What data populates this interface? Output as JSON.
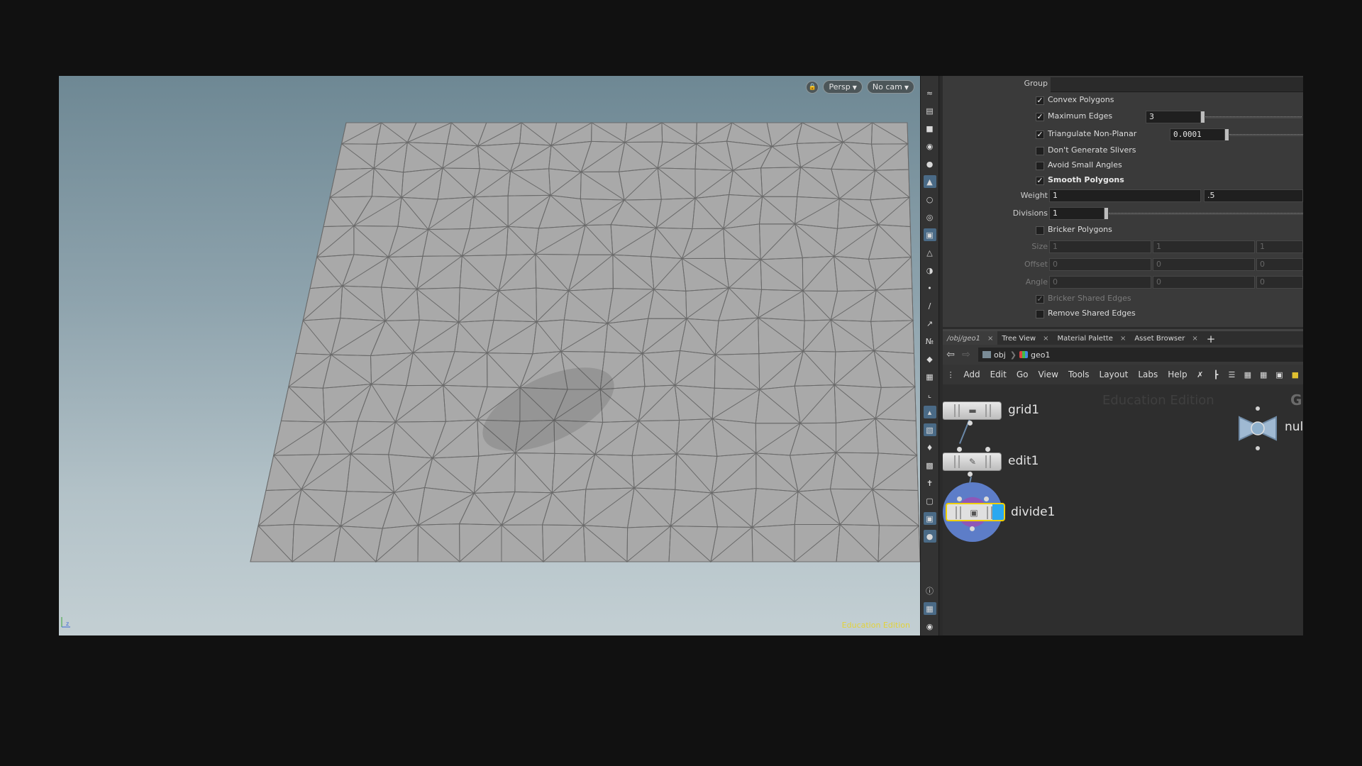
{
  "viewport": {
    "persp_label": "Persp",
    "cam_label": "No cam",
    "watermark": "Education Edition",
    "axis_label": "z"
  },
  "params": {
    "group_label": "Group",
    "convex_polygons": "Convex Polygons",
    "maximum_edges": "Maximum Edges",
    "maximum_edges_value": "3",
    "triangulate_non_planar": "Triangulate Non-Planar",
    "triangulate_value": "0.0001",
    "dont_generate_slivers": "Don't Generate Slivers",
    "avoid_small_angles": "Avoid Small Angles",
    "smooth_polygons": "Smooth Polygons",
    "weight_label": "Weight",
    "weight_value_1": "1",
    "weight_value_2": ".5",
    "divisions_label": "Divisions",
    "divisions_value": "1",
    "bricker_polygons": "Bricker Polygons",
    "size_label": "Size",
    "size_values": [
      "1",
      "1",
      "1"
    ],
    "offset_label": "Offset",
    "offset_values": [
      "0",
      "0",
      "0"
    ],
    "angle_label": "Angle",
    "angle_values": [
      "0",
      "0",
      "0"
    ],
    "bricker_shared_edges": "Bricker Shared Edges",
    "remove_shared_edges": "Remove Shared Edges"
  },
  "tabs": [
    {
      "label": "/obj/geo1"
    },
    {
      "label": "Tree View"
    },
    {
      "label": "Material Palette"
    },
    {
      "label": "Asset Browser"
    }
  ],
  "path": {
    "root": "obj",
    "current": "geo1"
  },
  "menu": [
    "Add",
    "Edit",
    "Go",
    "View",
    "Tools",
    "Layout",
    "Labs",
    "Help"
  ],
  "network": {
    "watermark": "Education Edition",
    "corner_glyph": "G",
    "nodes": [
      {
        "name": "grid1"
      },
      {
        "name": "edit1"
      },
      {
        "name": "divide1"
      }
    ],
    "null_partial": "nul"
  },
  "colors": {
    "selected_outline": "#f0d000",
    "display_flag": "#5d7dc8",
    "template_flag": "#8e57b8",
    "edu_watermark": "#e2d23a"
  }
}
